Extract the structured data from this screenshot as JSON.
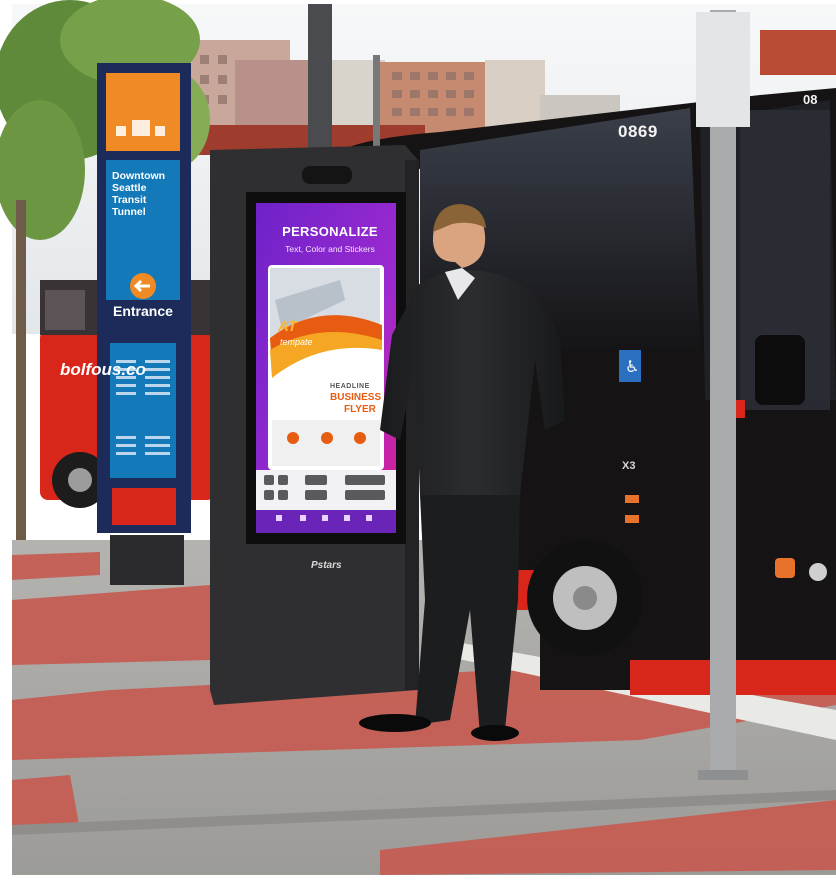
{
  "scene": {
    "sign": {
      "title": "Downtown Seattle Transit Tunnel",
      "entrance": "Entrance"
    },
    "bus": {
      "number": "0869",
      "number_right": "08",
      "brand": "bolfous.co",
      "model": "X3"
    },
    "kiosk": {
      "headline": "PERSONALIZE",
      "subline": "Text, Color and Stickers",
      "flyer_at": "AT",
      "flyer_tempate": "tempate",
      "flyer_headline": "HEADLINE",
      "flyer_business": "BUSINESS",
      "flyer_flyer": "FLYER",
      "brand": "Pstars"
    },
    "colors": {
      "sky": "#eef1f3",
      "bus_body": "#1a1618",
      "bus_red": "#d8261a",
      "brick": "#c8524a",
      "pavement": "#a9a9a7",
      "kiosk_frame": "#2f2f31",
      "screen_purple": "#7a2ed0",
      "screen_pink": "#e6208c",
      "sign_blue": "#1479b8",
      "sign_orange": "#f08a25",
      "sign_navy": "#1c2b5a"
    }
  }
}
